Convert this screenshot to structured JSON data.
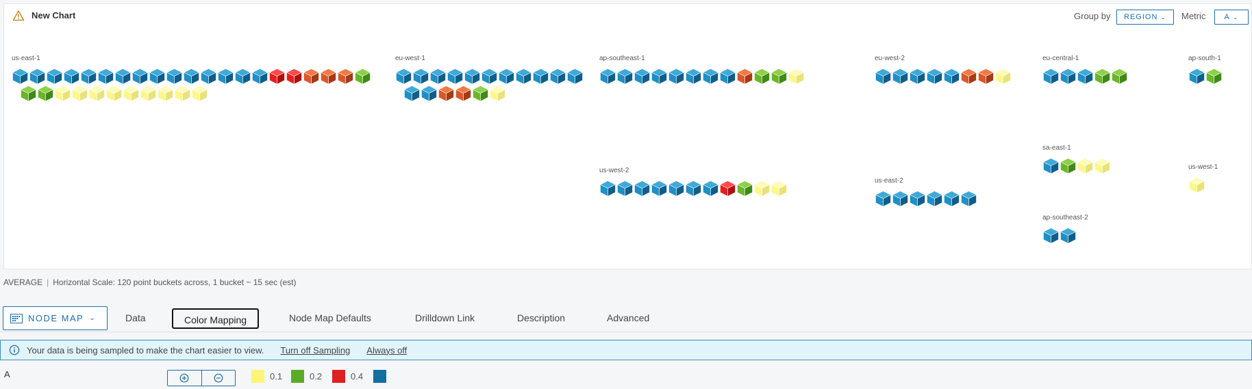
{
  "chart": {
    "title": "New Chart",
    "group_by_label": "Group by",
    "group_by_value": "REGION",
    "metric_label": "Metric",
    "metric_value": "A",
    "accent_color": "#1b6fa8"
  },
  "groups": [
    {
      "label": "us-east-1",
      "rows": [
        [
          "blue",
          "blue",
          "blue",
          "blue",
          "blue",
          "blue",
          "blue",
          "blue",
          "blue",
          "blue",
          "blue",
          "blue",
          "blue",
          "blue",
          "blue",
          "red",
          "red",
          "orange",
          "orange",
          "orange",
          "green"
        ],
        [
          "green",
          "green",
          "yellow",
          "yellow",
          "yellow",
          "yellow",
          "yellow",
          "yellow",
          "yellow",
          "yellow",
          "yellow"
        ]
      ]
    },
    {
      "label": "eu-west-1",
      "rows": [
        [
          "blue",
          "blue",
          "blue",
          "blue",
          "blue",
          "blue",
          "blue",
          "blue",
          "blue",
          "blue",
          "blue"
        ],
        [
          "blue",
          "blue",
          "orange",
          "orange",
          "green",
          "yellow"
        ]
      ]
    },
    {
      "label": "ap-southeast-1",
      "rows": [
        [
          "blue",
          "blue",
          "blue",
          "blue",
          "blue",
          "blue",
          "blue",
          "blue",
          "orange",
          "green",
          "green",
          "yellow"
        ]
      ]
    },
    {
      "label": "eu-west-2",
      "rows": [
        [
          "blue",
          "blue",
          "blue",
          "blue",
          "blue",
          "orange",
          "orange",
          "yellow"
        ]
      ]
    },
    {
      "label": "eu-central-1",
      "rows": [
        [
          "blue",
          "blue",
          "blue",
          "green",
          "green"
        ]
      ]
    },
    {
      "label": "ap-south-1",
      "rows": [
        [
          "blue",
          "green"
        ]
      ]
    },
    {
      "label": "us-west-2",
      "rows": [
        [
          "blue",
          "blue",
          "blue",
          "blue",
          "blue",
          "blue",
          "blue",
          "red",
          "green",
          "yellow",
          "yellow"
        ]
      ]
    },
    {
      "label": "us-east-2",
      "rows": [
        [
          "blue",
          "blue",
          "blue",
          "blue",
          "blue",
          "blue"
        ]
      ]
    },
    {
      "label": "sa-east-1",
      "rows": [
        [
          "blue",
          "green",
          "yellow",
          "yellow"
        ]
      ]
    },
    {
      "label": "us-west-1",
      "rows": [
        [
          "yellow"
        ]
      ]
    },
    {
      "label": "ap-southeast-2",
      "rows": [
        [
          "blue",
          "blue"
        ]
      ]
    }
  ],
  "cube_colors": {
    "blue": {
      "top": "#3fa9d8",
      "left": "#1f8fc4",
      "right": "#0f5e8a"
    },
    "green": {
      "top": "#8ed04a",
      "left": "#6cb52a",
      "right": "#3f8a17"
    },
    "yellow": {
      "top": "#fdfbb8",
      "left": "#fcf68d",
      "right": "#e8e27a"
    },
    "orange": {
      "top": "#f07a45",
      "left": "#d9582a",
      "right": "#a53a15"
    },
    "red": {
      "top": "#ff4b4b",
      "left": "#e51f1f",
      "right": "#b00f0f"
    }
  },
  "footer": {
    "aggregation": "AVERAGE",
    "scale_text": "Horizontal Scale: 120 point buckets across, 1 bucket ~ 15 sec (est)"
  },
  "tabs": {
    "node_map_label": "NODE MAP",
    "items": [
      "Data",
      "Color Mapping",
      "Node Map Defaults",
      "Drilldown Link",
      "Description",
      "Advanced"
    ],
    "active": "Color Mapping"
  },
  "banner": {
    "message": "Your data is being sampled to make the chart easier to view.",
    "turn_off_link": "Turn off Sampling",
    "always_off_link": "Always off",
    "background": "#e1f4fb"
  },
  "color_mapping": {
    "series_label": "A",
    "legend": [
      {
        "color": "#fff47a",
        "label": "0.1"
      },
      {
        "color": "#5aab26",
        "label": "0.2"
      },
      {
        "color": "#e02020",
        "label": "0.4"
      },
      {
        "color": "#136fa0",
        "label": ""
      }
    ]
  }
}
